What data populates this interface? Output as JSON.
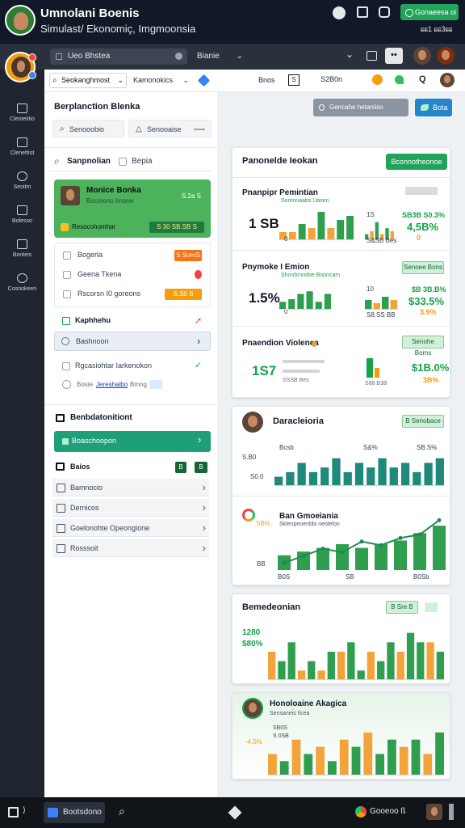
{
  "header": {
    "title": "Umnolani Boenis",
    "subtitle": "Simulast/ Ekonomiç, Imgmoonsia",
    "cta": "Gonaeesa oi",
    "num": "ɕɕ1 ɕɕ3ɕɕ"
  },
  "toolbar": {
    "tab": "Ueo Bhstea",
    "sel": "Bianie"
  },
  "appbar": {
    "search": "Seokanghmost",
    "sel": "Kamonokics",
    "b1": "Bnos",
    "b2": "S",
    "b3": "S2B0n",
    "q": "Q"
  },
  "sidebar": {
    "items": [
      "Cleoteiitio",
      "Clenettiot",
      "Seoitm",
      "Bolesso",
      "Bonteis",
      "Cosnokeen"
    ]
  },
  "left": {
    "title": "Berplanction Blenka",
    "f1": "Senooobio",
    "f2": "Senooaise",
    "search": "Sanpnolian",
    "search2": "Bepia",
    "profile": {
      "name": "Monice Bonka",
      "sub": "Bocmono Imorer",
      "badge": "S.2a S",
      "ptag": "Resocohomhar",
      "pval": "S 30 SB.SB S"
    },
    "list": [
      {
        "label": "Bogerla",
        "tag": "S SoroS"
      },
      {
        "label": "Geena Tkena",
        "tag": ""
      },
      {
        "label": "Rscorsn I0 goreons",
        "tag": "S.S0 S"
      }
    ],
    "kh": "Kaphhehu",
    "kh_item": "Bashnoon",
    "rk": "Rgcasiohtar Iarkenokon",
    "rk2": "Bosie",
    "rk2b": "Jereshaibo",
    "rk2c": "Bmng",
    "sec": "Benbdatonitiont",
    "sec_btn": "Boaschoopon",
    "sub": "Baios",
    "subt1": "B",
    "subt2": "B",
    "rows": [
      "Bamnocio",
      "Dernicos",
      "Goelonohte Opeongione",
      "Rosssoit"
    ]
  },
  "right": {
    "btn_grey": "Gencahe hetaniiso",
    "btn_blue": "Bota",
    "card1": {
      "title": "Panonelde Ieokan",
      "btn": "Bconnotheonoe",
      "m1": {
        "t": "Pnanpipr Pemintian",
        "s": "Somnnaabs Uasen",
        "v": "1 SB",
        "n2": "1S",
        "b1": "SB3B S0.3%",
        "b2": "4,5B%",
        "b3": "0",
        "b4": "S&SB Bes"
      },
      "m2": {
        "t": "Pnymoke I Emion",
        "s": "Shonbmndoe Bnoncam",
        "v": "1.5%",
        "btn": "Senoee Bons",
        "b1": "$B 3B.B%",
        "b2": "$33.5%",
        "b3": "3.9%",
        "n1": "10",
        "n2": "S8.SS BB"
      },
      "m3": {
        "t": "Pnaendion Violenea",
        "s": "",
        "v": "1S7",
        "btn": "Senohe Boms",
        "b1": "$1B.0%",
        "b2": "3B%",
        "n1": "SSSB Bes",
        "n2": "S88 B3B"
      }
    },
    "card2": {
      "title": "Daracleioria",
      "btn": "B Senobace",
      "ax1": "S.B0",
      "ax2": "S0.0",
      "ax3": "BB",
      "h1": "Ban Gmoeiania",
      "h2": "Sklenpeoenbbi neolelon",
      "p": "5B%",
      "bl1": "Bcsb",
      "bl2": "S&%",
      "bl3": "SB.S%",
      "x1": "B0S",
      "x2": "SB",
      "x3": "B0Sb"
    },
    "card3": {
      "title": "Bemedeonian",
      "btn": "B Sre B",
      "y1": "1280",
      "y2": "$80%"
    },
    "card4": {
      "title": "Honoloaine Akagica",
      "sub": "Sensaneis Ilcea",
      "p": "-4.5%",
      "v1": "SB0S",
      "v2": "S 0SB"
    }
  },
  "taskbar": {
    "app": "Bootsdono",
    "right": "Gooeoo ß"
  },
  "chart_data": [
    {
      "type": "bar",
      "title": "Pnanpipr Pemintian",
      "values": [
        2,
        2,
        4,
        3,
        7,
        3,
        5,
        6
      ],
      "series": [
        {
          "name": "",
          "values": [
            2,
            3,
            6
          ]
        },
        {
          "name": "",
          "values": [
            2,
            4,
            3
          ]
        }
      ]
    },
    {
      "type": "bar",
      "title": "Pnymoke I Emion",
      "values": [
        3,
        4,
        6,
        7,
        3,
        6
      ]
    },
    {
      "type": "bar",
      "title": "Daracleioria",
      "values": [
        2,
        3,
        5,
        3,
        4,
        6,
        3,
        5,
        4,
        6,
        4,
        5,
        3,
        5,
        6
      ]
    },
    {
      "type": "line",
      "title": "Ban Gmoeiania",
      "values": [
        1,
        2,
        3,
        2.5,
        4,
        3.5,
        4.5,
        5,
        7
      ],
      "bars": [
        2,
        2.5,
        3,
        3.5,
        3,
        3.5,
        4,
        5,
        6
      ]
    },
    {
      "type": "bar",
      "title": "Bemedeonian",
      "values": [
        3,
        2,
        4,
        1,
        2,
        1,
        3,
        3,
        4,
        1,
        3,
        2,
        4,
        3,
        5,
        4,
        4,
        3
      ]
    },
    {
      "type": "bar",
      "title": "Honoloaine Akagica",
      "values": [
        3,
        2,
        5,
        3,
        4,
        2,
        5,
        4,
        6,
        3,
        5,
        4,
        5,
        3,
        6
      ]
    }
  ]
}
